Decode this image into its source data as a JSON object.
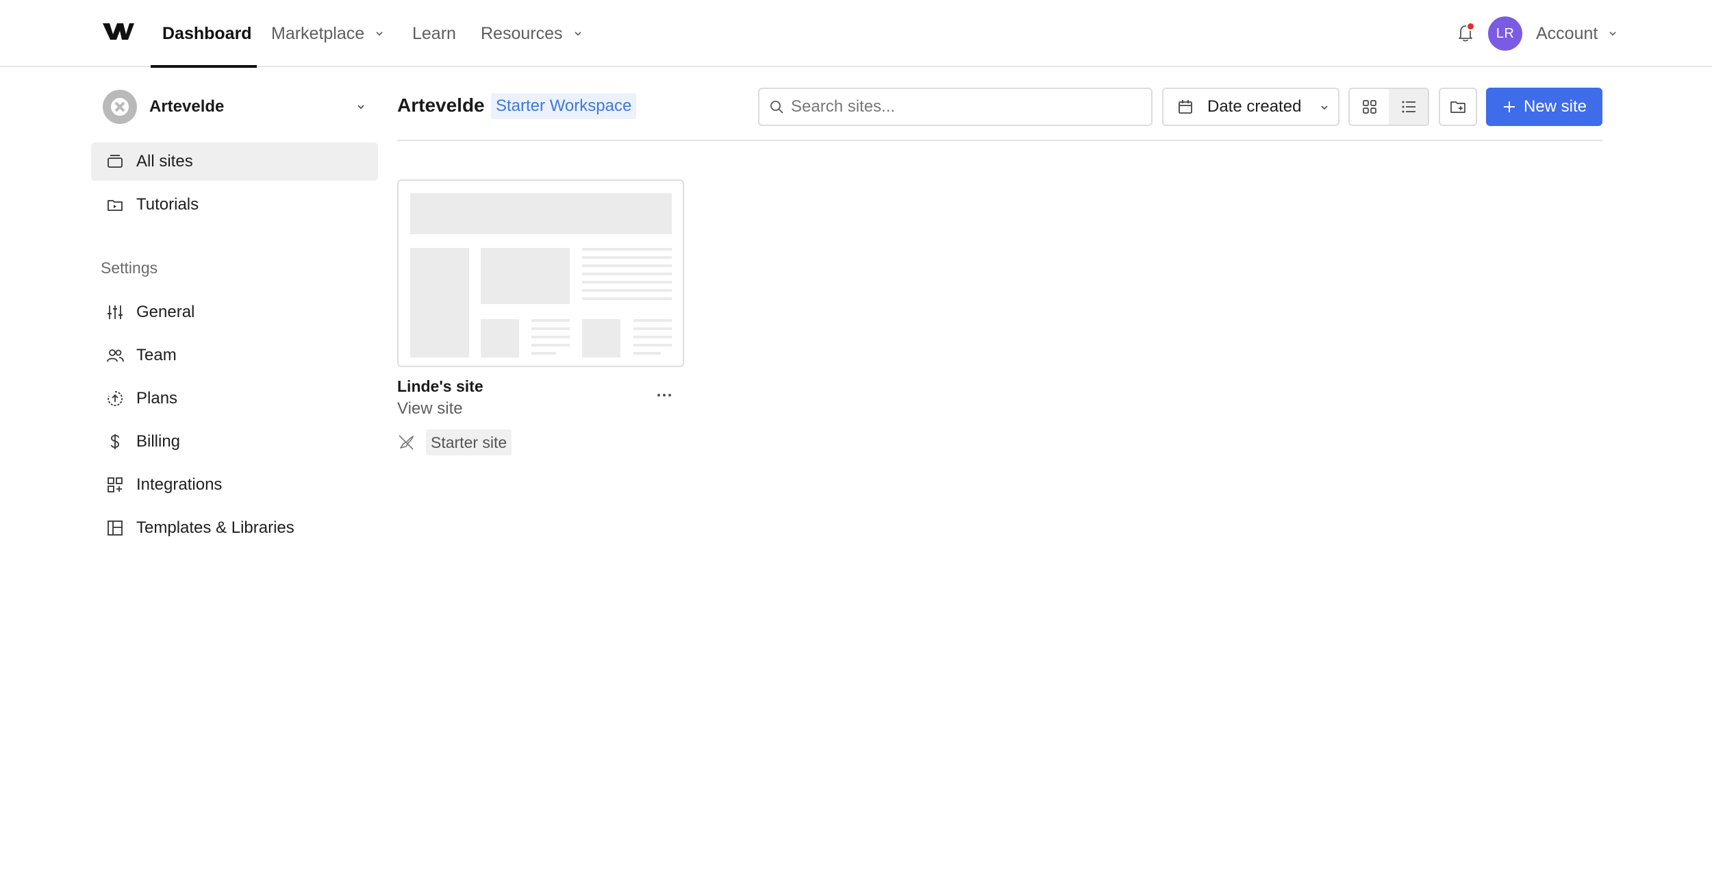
{
  "topnav": {
    "items": [
      {
        "label": "Dashboard",
        "active": true
      },
      {
        "label": "Marketplace",
        "has_menu": true
      },
      {
        "label": "Learn"
      },
      {
        "label": "Resources",
        "has_menu": true
      }
    ],
    "avatar_initials": "LR",
    "account_label": "Account",
    "notification_dot_color": "#e22d2d",
    "avatar_color": "#7b5ae4"
  },
  "sidebar": {
    "workspace_name": "Artevelde",
    "items": [
      {
        "label": "All sites",
        "icon": "sites-icon",
        "selected": true
      },
      {
        "label": "Tutorials",
        "icon": "tutorials-folder-icon"
      }
    ],
    "settings_heading": "Settings",
    "settings_items": [
      {
        "label": "General",
        "icon": "sliders-icon"
      },
      {
        "label": "Team",
        "icon": "team-icon"
      },
      {
        "label": "Plans",
        "icon": "plans-icon"
      },
      {
        "label": "Billing",
        "icon": "dollar-icon"
      },
      {
        "label": "Integrations",
        "icon": "integrations-icon"
      },
      {
        "label": "Templates & Libraries",
        "icon": "templates-icon"
      }
    ]
  },
  "main": {
    "title": "Artevelde",
    "workspace_badge": "Starter Workspace",
    "search_placeholder": "Search sites...",
    "sort_label": "Date created",
    "new_site_label": "New site",
    "accent_color": "#3f6ce9",
    "sites": [
      {
        "name": "Linde's site",
        "link": "View site",
        "badge": "Starter site"
      }
    ]
  }
}
